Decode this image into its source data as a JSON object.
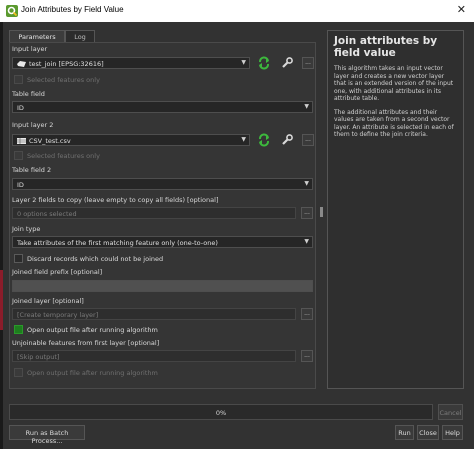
{
  "window": {
    "title": "Join Attributes by Field Value",
    "icon": "qgis-icon",
    "close_glyph": "✕"
  },
  "tabs": [
    {
      "label": "Parameters",
      "active": true
    },
    {
      "label": "Log",
      "active": false
    }
  ],
  "params": {
    "input_layer": {
      "label": "Input layer",
      "value": "test_join [EPSG:32616]",
      "selected_only_label": "Selected features only"
    },
    "table_field": {
      "label": "Table field",
      "value": "ID"
    },
    "input_layer_2": {
      "label": "Input layer 2",
      "value": "CSV_test.csv",
      "selected_only_label": "Selected features only"
    },
    "table_field_2": {
      "label": "Table field 2",
      "value": "ID"
    },
    "fields_to_copy": {
      "label": "Layer 2 fields to copy (leave empty to copy all fields) [optional]",
      "value": "0 options selected",
      "button": "..."
    },
    "join_type": {
      "label": "Join type",
      "value": "Take attributes of the first matching feature only (one-to-one)"
    },
    "discard_label": "Discard records which could not be joined",
    "prefix": {
      "label": "Joined field prefix [optional]",
      "value": ""
    },
    "joined_layer": {
      "label": "Joined layer [optional]",
      "value": "[Create temporary layer]",
      "button": "..."
    },
    "open_output_label": "Open output file after running algorithm",
    "unjoinable": {
      "label": "Unjoinable features from first layer [optional]",
      "value": "[Skip output]",
      "button": "..."
    },
    "open_output_label_2": "Open output file after running algorithm",
    "small_button": "..."
  },
  "help": {
    "title": "Join attributes by field value",
    "paragraphs": [
      "This algorithm takes an input vector layer and creates a new vector layer that is an extended version of the input one, with additional attributes in its attribute table.",
      "The additional attributes and their values are taken from a second vector layer. An attribute is selected in each of them to define the join criteria."
    ]
  },
  "progress": {
    "percent": 0,
    "text": "0%"
  },
  "buttons": {
    "cancel": "Cancel",
    "batch": "Run as Batch Process...",
    "run": "Run",
    "close": "Close",
    "help": "Help"
  },
  "colors": {
    "accent_green": "#3db83d",
    "checked_green": "#1e7d1e",
    "background": "#323232"
  }
}
